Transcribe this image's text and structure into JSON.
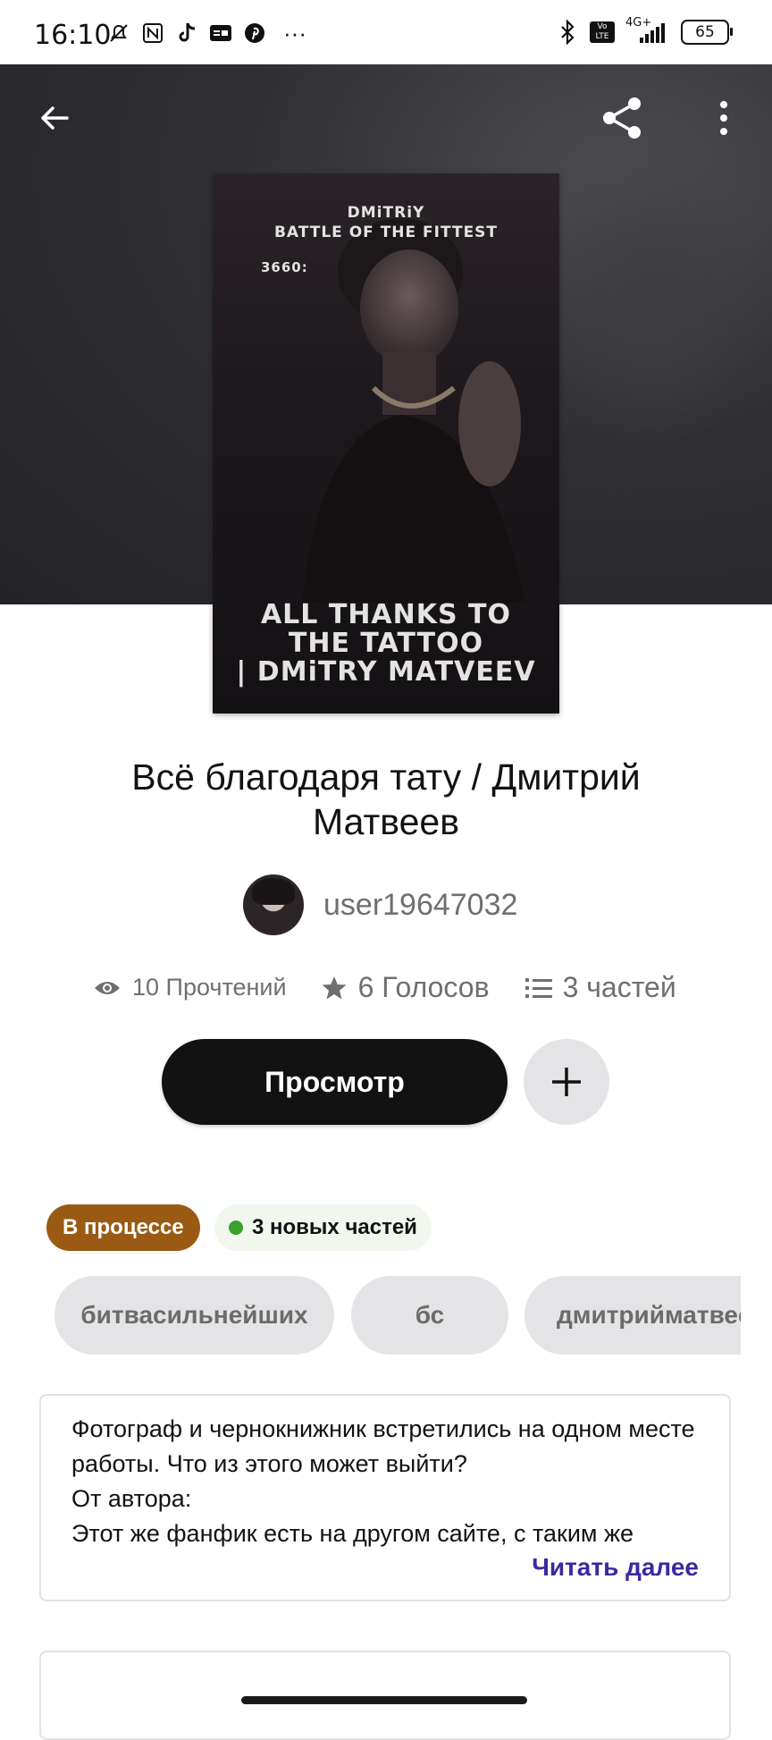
{
  "status_bar": {
    "time": "16:10",
    "network": "4G+",
    "volte": "Vo LTE",
    "battery": "65",
    "more": "···"
  },
  "toolbar": {
    "back_icon": "arrow-left-icon",
    "share_icon": "share-icon",
    "more_icon": "more-vertical-icon"
  },
  "cover": {
    "line1": "DMiTRiY",
    "line2": "BATTLE OF THE FITTEST",
    "line3": "3660:",
    "bottom1": "ALL THANKS TO",
    "bottom2": "THE TATTOO",
    "bottom3": "| DMiTRY MATVEEV"
  },
  "story": {
    "title": "Всё благодаря тату / Дмитрий Матвеев",
    "author": "user19647032",
    "reads": "10 Прочтений",
    "votes": "6 Голосов",
    "parts": "3 частей"
  },
  "actions": {
    "read_label": "Просмотр",
    "add_icon": "plus-icon"
  },
  "badges": {
    "status": "В процессе",
    "new_parts": "3 новых частей"
  },
  "tags": [
    "битвасильнейших",
    "бс",
    "дмитрийматвеев"
  ],
  "description": {
    "text": "Фотограф и чернокнижник встретились на одном месте работы. Что из этого может выйти?\nОт автора:\nЭтот же фанфик есть на другом сайте, с таким же",
    "read_more": "Читать далее"
  }
}
